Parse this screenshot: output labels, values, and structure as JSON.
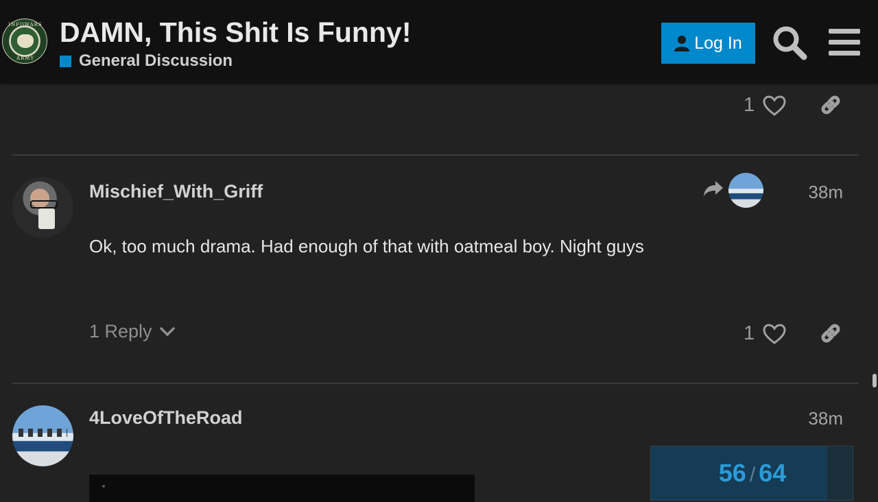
{
  "header": {
    "title": "DAMN, This Shit Is Funny!",
    "category": "General Discussion",
    "category_color": "#0088cc",
    "login_label": "Log In",
    "logo_text_top": "INFOWARS",
    "logo_text_bottom": "ARMY"
  },
  "posts": [
    {
      "likes": "1"
    },
    {
      "username": "Mischief_With_Griff",
      "time": "38m",
      "body": "Ok, too much drama. Had enough of that with oatmeal boy. Night guys",
      "reply_label": "1 Reply",
      "likes": "1"
    },
    {
      "username": "4LoveOfTheRoad",
      "time": "38m"
    }
  ],
  "progress": {
    "current": "56",
    "separator": "/",
    "total": "64",
    "fraction": 0.875
  },
  "colors": {
    "accent": "#0088cc",
    "background": "#222222",
    "header": "#111111"
  }
}
